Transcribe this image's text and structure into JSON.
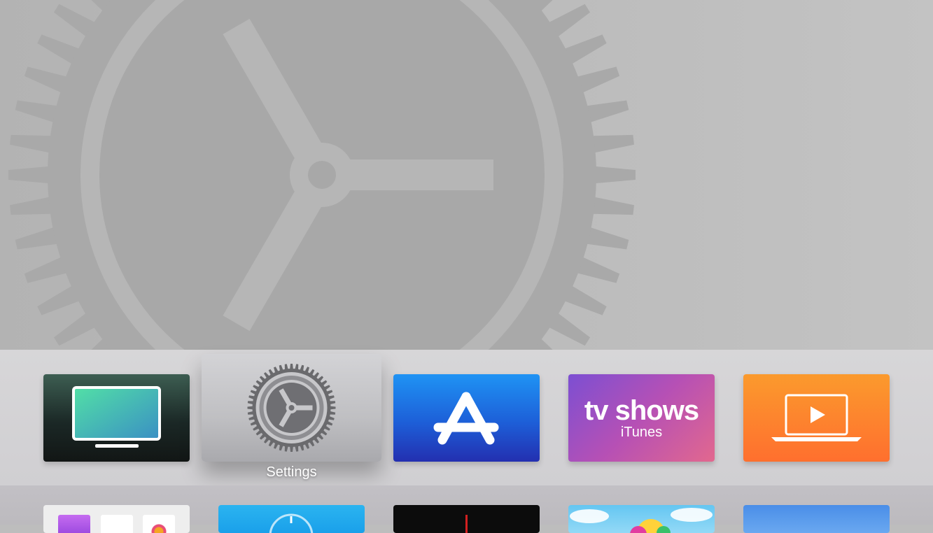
{
  "focused_app": {
    "label": "Settings"
  },
  "top_shelf": {
    "background_icon": "gear-icon"
  },
  "dock": {
    "row1": [
      {
        "id": "tv",
        "icon": "tv-screen-icon",
        "colors": [
          "#3d5e52",
          "#121615"
        ]
      },
      {
        "id": "settings",
        "icon": "gear-icon",
        "colors": [
          "#d3d3d6",
          "#a9a9ad"
        ]
      },
      {
        "id": "app-store",
        "icon": "app-store-icon",
        "colors": [
          "#1f93f4",
          "#232fb0"
        ]
      },
      {
        "id": "tv-shows",
        "title": "tv shows",
        "subtitle": "iTunes",
        "colors": [
          "#7c4fd2",
          "#e2688e"
        ]
      },
      {
        "id": "movies",
        "icon": "laptop-play-icon",
        "colors": [
          "#fb9a2d",
          "#ff6f2e"
        ]
      }
    ],
    "row2": [
      {
        "id": "folder",
        "icons": [
          "podcast-icon",
          "music-note-icon",
          "photos-icon"
        ]
      },
      {
        "id": "blue-app",
        "icon": "compass-icon"
      },
      {
        "id": "black-app"
      },
      {
        "id": "cartoon-app"
      },
      {
        "id": "sky-app"
      }
    ]
  }
}
